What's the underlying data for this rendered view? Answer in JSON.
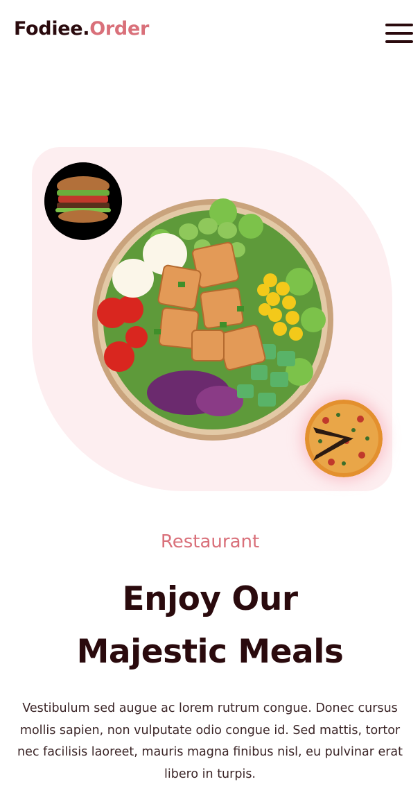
{
  "header": {
    "logo_main": "Fodiee.",
    "logo_accent": "Order",
    "menu_icon": "hamburger-menu-icon"
  },
  "hero": {
    "images": [
      "salad-bowl",
      "burger",
      "pizza"
    ]
  },
  "intro": {
    "eyebrow": "Restaurant",
    "headline_line1": "Enjoy Our",
    "headline_line2": "Majestic Meals",
    "body": "Vestibulum sed augue ac lorem rutrum congue. Donec cursus mollis sapien, non vulputate odio congue id. Sed mattis, tortor nec facilisis laoreet, mauris magna finibus nisl, eu pulvinar erat libero in turpis."
  },
  "colors": {
    "brand_dark": "#2a0a0d",
    "brand_accent": "#d9707a",
    "hero_bg": "#fdeef0"
  }
}
